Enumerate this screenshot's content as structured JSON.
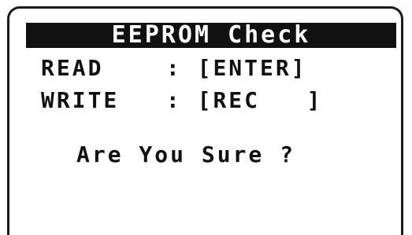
{
  "screen": {
    "title": "EEPROM Check",
    "rows": [
      {
        "label": "READ",
        "separator": ":",
        "key": "[ENTER]"
      },
      {
        "label": "WRITE",
        "separator": ":",
        "key": "[REC   ]"
      }
    ],
    "prompt": "Are You Sure ?"
  },
  "colors": {
    "background": "#ffffff",
    "ink": "#111111",
    "title_text": "#ffffff"
  }
}
